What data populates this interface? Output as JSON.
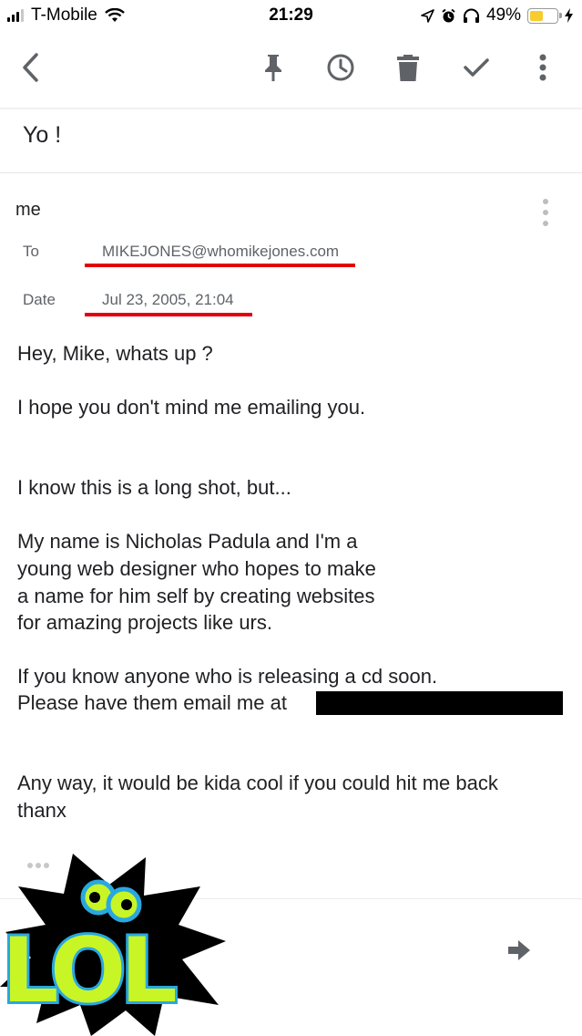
{
  "status_bar": {
    "carrier": "T-Mobile",
    "time": "21:29",
    "battery_percent": "49%",
    "battery_level": 0.49,
    "icons": [
      "signal-icon",
      "wifi-icon",
      "location-icon",
      "alarm-icon",
      "headphones-icon",
      "battery-icon",
      "charging-icon"
    ]
  },
  "toolbar": {
    "icons": [
      "back-arrow-icon",
      "pin-icon",
      "snooze-clock-icon",
      "trash-icon",
      "check-icon",
      "more-vertical-icon"
    ]
  },
  "email": {
    "subject": "Yo !",
    "sender": "me",
    "to_label": "To",
    "to_value": "MIKEJONES@whomikejones.com",
    "date_label": "Date",
    "date_value": "Jul 23, 2005, 21:04",
    "body": [
      "Hey, Mike, whats up ?",
      "I hope you don't mind me emailing you.",
      "I know this is a long shot, but...",
      "My name is Nicholas Padula and I'm a",
      "young web designer who hopes to make",
      "a name for him self by creating websites",
      "for amazing projects like urs.",
      "If you know anyone who is releasing a cd soon.",
      "Please have them email me at",
      "Any way, it would be kida cool if you could hit me back",
      "thanx"
    ]
  },
  "sticker": {
    "text": "LOL",
    "colors": {
      "burst": "#000000",
      "letters": "#c8f526",
      "outline": "#29a8e0"
    }
  },
  "colors": {
    "underline": "#e3000b",
    "icon": "#5f6368"
  }
}
